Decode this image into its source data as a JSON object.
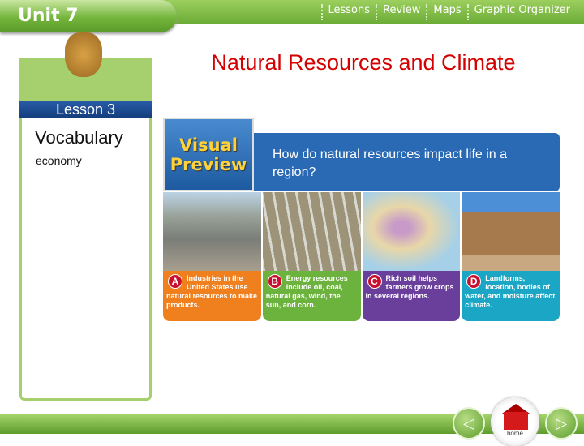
{
  "header": {
    "unit": "Unit 7",
    "nav": [
      "Lessons",
      "Review",
      "Maps",
      "Graphic Organizer"
    ]
  },
  "title": "Natural Resources and Climate",
  "sidebar": {
    "lesson": "Lesson 3",
    "heading": "Vocabulary",
    "terms": [
      "economy"
    ]
  },
  "visual_preview": {
    "logo_line1": "Visual",
    "logo_line2": "Preview",
    "question": "How do natural resources impact life in a region?"
  },
  "cards": [
    {
      "letter": "A",
      "text": "Industries in the United States use natural resources to make products.",
      "color": "#f07f1e"
    },
    {
      "letter": "B",
      "text": "Energy resources include oil, coal, natural gas, wind, the sun, and corn.",
      "color": "#6cb33e"
    },
    {
      "letter": "C",
      "text": "Rich soil helps farmers grow crops in several regions.",
      "color": "#6a3f9c"
    },
    {
      "letter": "D",
      "text": "Landforms, location, bodies of water, and moisture affect climate.",
      "color": "#1aa6c4"
    }
  ],
  "footer": {
    "prev": "◁",
    "next": "▷",
    "home": "home"
  }
}
